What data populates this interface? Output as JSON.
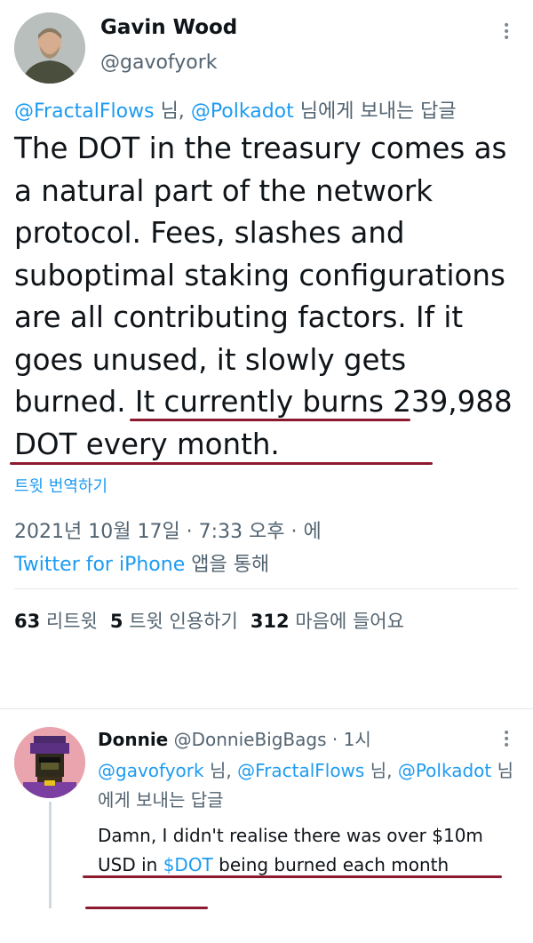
{
  "main_tweet": {
    "author_name": "Gavin Wood",
    "author_handle": "@gavofyork",
    "reply_to": {
      "mention1": "@FractalFlows",
      "sep1": " 님, ",
      "mention2": "@Polkadot",
      "suffix": " 님에게 보내는 답글"
    },
    "text_part1": "The DOT in the treasury comes as a natural part of the network protocol. Fees, slashes and suboptimal staking configurations are all contributing factors. If it goes unused, it slowly gets burned. It currently burns 239,988 DOT every month.",
    "translate_label": "트윗 번역하기",
    "timestamp": "2021년 10월 17일 · 7:33 오후 · 에",
    "source_link": "Twitter for iPhone",
    "source_suffix": " 앱을 통해",
    "stats": {
      "retweets_count": "63",
      "retweets_label": "리트윗",
      "quotes_count": "5",
      "quotes_label": "트윗 인용하기",
      "likes_count": "312",
      "likes_label": "마음에 들어요"
    }
  },
  "reply_tweet": {
    "author_name": "Donnie",
    "author_handle": "@DonnieBigBags",
    "time": " · 1시",
    "reply_to": {
      "mention1": "@gavofyork",
      "sep1": " 님, ",
      "mention2": "@FractalFlows",
      "sep2": " 님, ",
      "mention3": "@Polkadot",
      "suffix": " 님에게 보내는 답글"
    },
    "text_before": "Damn, I didn't realise there was over $10m USD in ",
    "cashtag": "$DOT",
    "text_after": " being burned each month"
  },
  "colors": {
    "link": "#1d9bf0",
    "secondary_text": "#536471",
    "annotation_underline": "#8b1a2e"
  }
}
